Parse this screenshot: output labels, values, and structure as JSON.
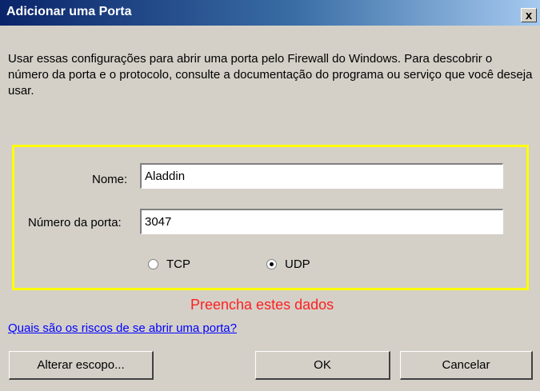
{
  "window": {
    "title": "Adicionar uma Porta",
    "close_glyph": "x"
  },
  "description": "Usar essas configurações para abrir uma porta pelo Firewall do Windows. Para descobrir o número da porta e o protocolo, consulte a documentação do programa ou serviço que você deseja usar.",
  "form": {
    "name_label": "Nome:",
    "name_value": "Aladdin",
    "port_label": "Número da porta:",
    "port_value": "3047",
    "protocols": [
      {
        "label": "TCP",
        "checked": false
      },
      {
        "label": "UDP",
        "checked": true
      }
    ]
  },
  "annotation": {
    "text": "Preencha estes dados",
    "color": "#ff2020",
    "highlight_color": "#ffff00"
  },
  "risk_link": "Quais são os riscos de se abrir uma porta?",
  "buttons": {
    "change_scope": "Alterar escopo...",
    "ok": "OK",
    "cancel": "Cancelar"
  }
}
